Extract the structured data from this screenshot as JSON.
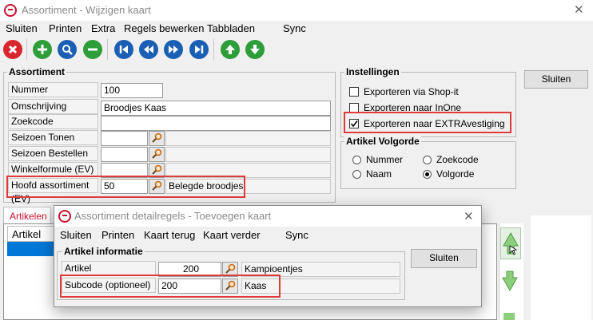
{
  "window": {
    "title": "Assortiment - Wijzigen kaart",
    "close_glyph": "✕"
  },
  "menu": [
    "Sluiten",
    "Printen",
    "Extra",
    "Regels bewerken",
    "Tabbladen",
    "Sync"
  ],
  "toolbar": {
    "buttons": [
      "close-icon",
      "add-icon",
      "search-icon",
      "remove-icon",
      "first-icon",
      "prev-icon",
      "next-icon",
      "last-icon",
      "up-icon",
      "down-icon"
    ]
  },
  "assortiment": {
    "legend": "Assortiment",
    "fields": {
      "nummer_label": "Nummer",
      "nummer_value": "100",
      "omschrijving_label": "Omschrijving",
      "omschrijving_value": "Broodjes Kaas",
      "zoekcode_label": "Zoekcode",
      "zoekcode_value": "",
      "seizoen_tonen_label": "Seizoen Tonen",
      "seizoen_bestellen_label": "Seizoen Bestellen",
      "winkelformule_label": "Winkelformule (EV)",
      "hoofd_label": "Hoofd assortiment (EV)",
      "hoofd_value": "50",
      "hoofd_desc": "Belegde broodjes"
    }
  },
  "instellingen": {
    "legend": "Instellingen",
    "options": [
      {
        "label": "Exporteren via Shop-it",
        "checked": false
      },
      {
        "label": "Exporteren naar InOne",
        "checked": false
      },
      {
        "label": "Exporteren naar EXTRAvestiging",
        "checked": true
      }
    ]
  },
  "volgorde": {
    "legend": "Artikel Volgorde",
    "options": [
      {
        "label": "Nummer",
        "selected": false
      },
      {
        "label": "Zoekcode",
        "selected": false
      },
      {
        "label": "Naam",
        "selected": false
      },
      {
        "label": "Volgorde",
        "selected": true
      }
    ]
  },
  "sluiten_button": "Sluiten",
  "tabs": {
    "active": "Artikelen",
    "grid_header": "Artikel"
  },
  "dialog": {
    "title": "Assortiment detailregels - Toevoegen kaart",
    "close_glyph": "✕",
    "menu": [
      "Sluiten",
      "Printen",
      "Kaart terug",
      "Kaart verder",
      "Sync"
    ],
    "legend": "Artikel informatie",
    "artikel_label": "Artikel",
    "artikel_value": "200",
    "artikel_desc": "Kampioentjes",
    "subcode_label": "Subcode (optioneel)",
    "subcode_value": "200",
    "subcode_desc": "Kaas",
    "sluiten_button": "Sluiten"
  },
  "colors": {
    "highlight_red": "#e03a3a",
    "selection_blue": "#0078d7",
    "toolbar_green": "#2e9e3a",
    "toolbar_blue": "#1a5fb4",
    "toolbar_red": "#d9262c"
  }
}
